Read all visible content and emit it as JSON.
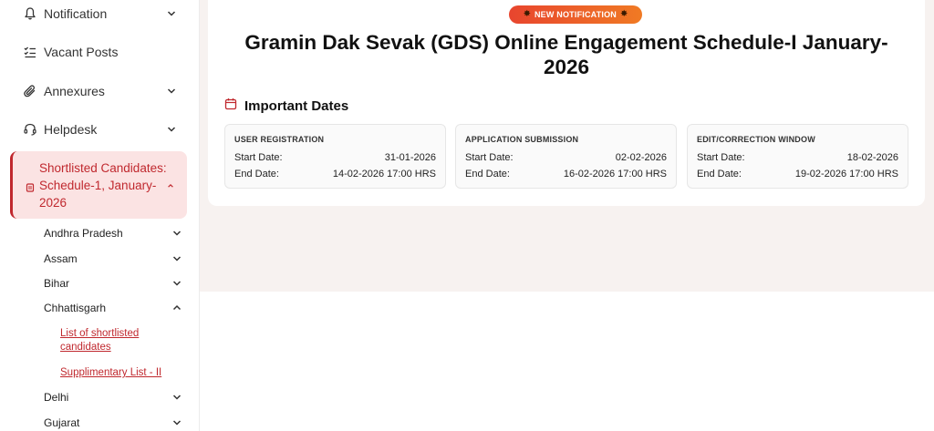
{
  "sidebar": {
    "items": [
      {
        "label": "Notification",
        "icon": "bell-icon"
      },
      {
        "label": "Vacant Posts",
        "icon": "list-check-icon"
      },
      {
        "label": "Annexures",
        "icon": "paperclip-icon"
      },
      {
        "label": "Helpdesk",
        "icon": "headset-icon"
      }
    ],
    "active": {
      "label": "Shortlisted Candidates: Schedule-1, January-2026",
      "icon": "document-icon"
    },
    "states": [
      {
        "label": "Andhra Pradesh"
      },
      {
        "label": "Assam"
      },
      {
        "label": "Bihar"
      },
      {
        "label": "Chhattisgarh"
      },
      {
        "label": "Delhi"
      },
      {
        "label": "Gujarat"
      }
    ],
    "chhattisgarh_links": [
      {
        "label": "List of shortlisted candidates"
      },
      {
        "label": "Supplimentary List - II"
      }
    ]
  },
  "main": {
    "badge": "NEW NOTIFICATION",
    "title": "Gramin Dak Sevak (GDS) Online Engagement Schedule-I January-2026",
    "section_title": "Important Dates",
    "section_icon": "calendar-icon",
    "date_cards": [
      {
        "title": "USER REGISTRATION",
        "start_label": "Start Date:",
        "start": "31-01-2026",
        "end_label": "End Date:",
        "end": "14-02-2026 17:00 HRS"
      },
      {
        "title": "APPLICATION SUBMISSION",
        "start_label": "Start Date:",
        "start": "02-02-2026",
        "end_label": "End Date:",
        "end": "16-02-2026 17:00 HRS"
      },
      {
        "title": "EDIT/CORRECTION WINDOW",
        "start_label": "Start Date:",
        "start": "18-02-2026",
        "end_label": "End Date:",
        "end": "19-02-2026 17:00 HRS"
      }
    ]
  },
  "colors": {
    "accent": "#c0282e",
    "active_bg": "#fbe3e3",
    "badge_start": "#e8452e",
    "badge_end": "#f07a24"
  }
}
